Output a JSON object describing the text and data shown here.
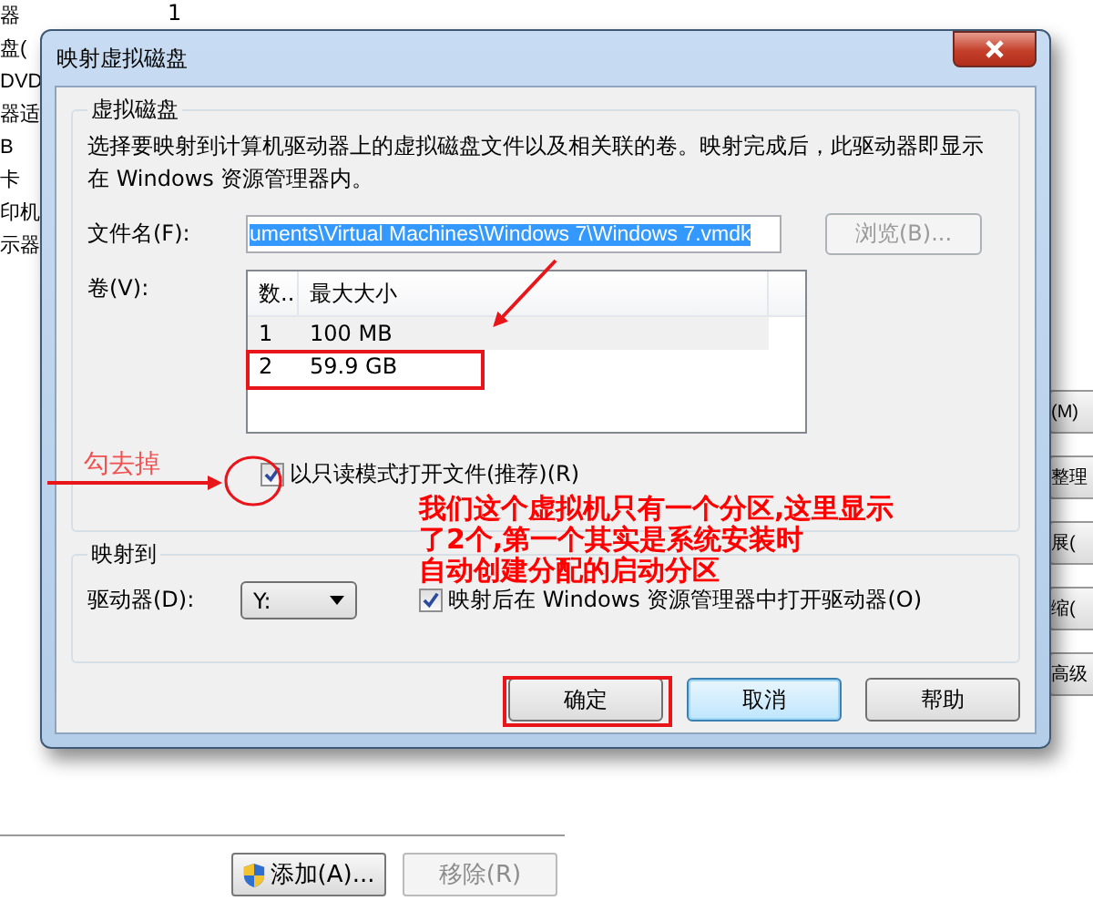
{
  "background_window": {
    "left_items": [
      "器",
      "盘(",
      "DVD",
      "器适",
      "B",
      "卡",
      "印机",
      "示器"
    ],
    "count": "1",
    "right_buttons": [
      "(M)",
      "整理",
      "展(",
      "缩(",
      "高级"
    ],
    "bottom_buttons": [
      {
        "label": "添加(A)...",
        "disabled": false,
        "kind": "shield"
      },
      {
        "label": "移除(R)",
        "disabled": true,
        "kind": "plain"
      }
    ]
  },
  "dialog": {
    "title": "映射虚拟磁盘",
    "virtual_disk": {
      "title": "虚拟磁盘",
      "description": "选择要映射到计算机驱动器上的虚拟磁盘文件以及相关联的卷。映射完成后，此驱动器即显示在 Windows 资源管理器内。",
      "file_label": "文件名(F):",
      "file_value": "uments\\Virtual Machines\\Windows 7\\Windows 7.vmdk",
      "browse": {
        "label": "浏览(B)...",
        "disabled": true
      },
      "volume_label": "卷(V):",
      "columns": [
        "数..",
        "最大大小"
      ],
      "rows": [
        {
          "number": "1",
          "size": "100 MB",
          "selected": true
        },
        {
          "number": "2",
          "size": "59.9 GB",
          "selected": false
        }
      ],
      "readonly": {
        "label": "以只读模式打开文件(推荐)(R)",
        "checked": true
      }
    },
    "map_to": {
      "title": "映射到",
      "drive_label": "驱动器(D):",
      "drive_value": "Y:",
      "open_after": {
        "label": "映射后在 Windows 资源管理器中打开驱动器(O)",
        "checked": true
      }
    },
    "buttons": [
      {
        "label": "确定",
        "default": false
      },
      {
        "label": "取消",
        "default": true
      },
      {
        "label": "帮助",
        "default": false
      }
    ]
  },
  "annotations": {
    "hint": "勾去掉",
    "note_lines": [
      "我们这个虚拟机只有一个分区,这里显示",
      "了2个,第一个其实是系统安装时",
      "自动创建分配的启动分区"
    ]
  }
}
